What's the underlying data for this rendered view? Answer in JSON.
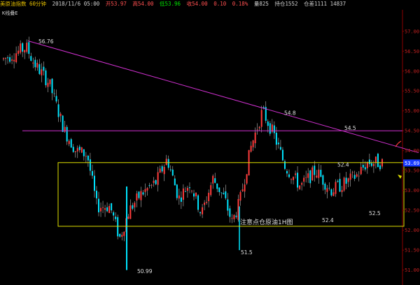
{
  "header": {
    "title": "美原油指数 60分钟",
    "date": "2018/11/6 05:00",
    "open": "开53.97",
    "high": "高54.00",
    "low": "低53.96",
    "close": "收54.00",
    "change": "0.10",
    "pct": "0.18%",
    "vol": "量825",
    "hold": "持仓1552",
    "extra": "仓差1111 14837"
  },
  "subhead": "K线叠E",
  "chart_data": {
    "type": "candlestick",
    "y_axis_ticks": [
      "57.00",
      "56.50",
      "56.00",
      "55.50",
      "55.00",
      "54.50",
      "54.00",
      "53.50",
      "53.00",
      "52.50",
      "52.00",
      "51.50",
      "51.00"
    ],
    "ylim": [
      50.8,
      57.4
    ],
    "last_price": "53.69",
    "annotations": [
      "56.76",
      "54.8",
      "54.5",
      "52.4",
      "52.4",
      "52.5",
      "51.5",
      "50.99",
      "注意点仓原油1H图"
    ],
    "range_box": {
      "top": 53.7,
      "bottom": 52.1
    },
    "horizontal_level": 54.5,
    "trendline": {
      "from": 56.76,
      "to": 54.0
    },
    "colors": {
      "up": "#ff3c3c",
      "down": "#00e5ff",
      "trend": "#d030d0",
      "box": "#e0e000",
      "wick": "#bbbbbb"
    }
  }
}
